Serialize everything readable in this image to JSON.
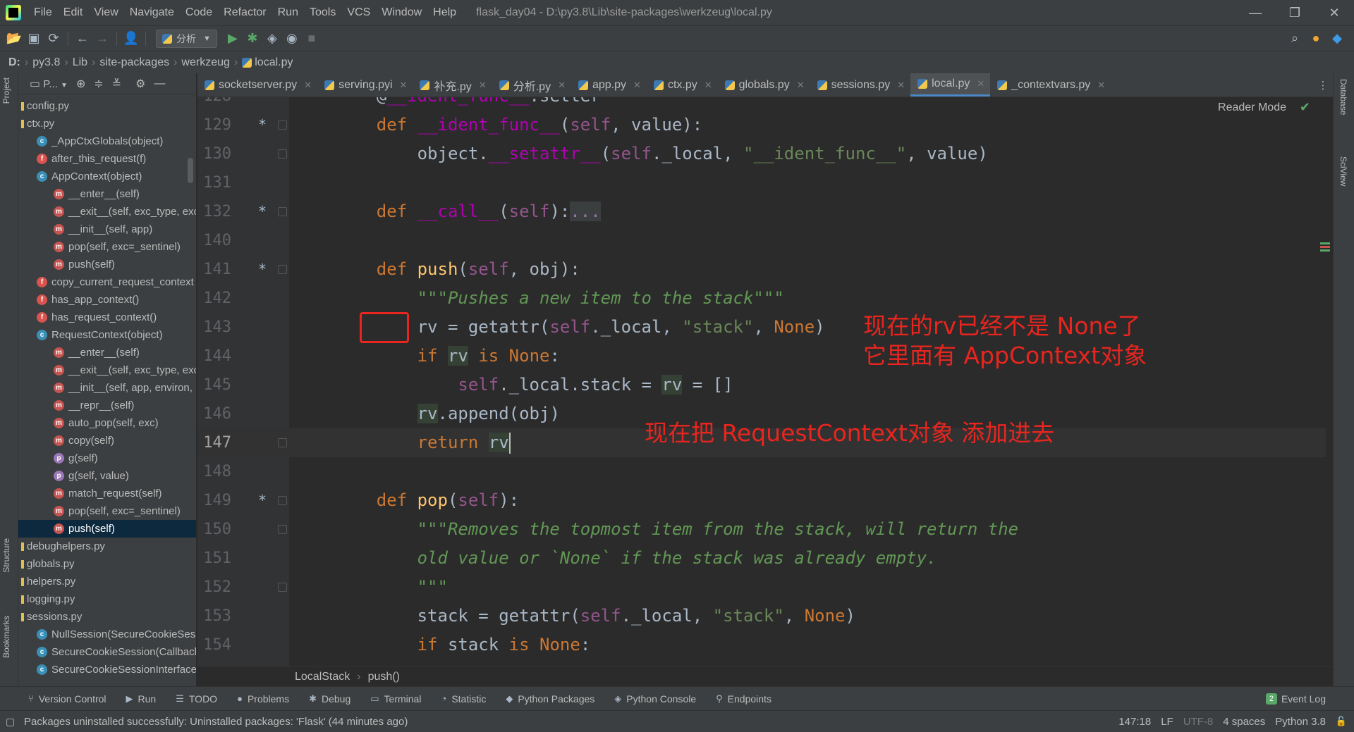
{
  "window": {
    "title": "flask_day04 - D:\\py3.8\\Lib\\site-packages\\werkzeug\\local.py",
    "menu": [
      "File",
      "Edit",
      "View",
      "Navigate",
      "Code",
      "Refactor",
      "Run",
      "Tools",
      "VCS",
      "Window",
      "Help"
    ],
    "controls": {
      "minimize": "—",
      "restore": "❐",
      "close": "✕"
    }
  },
  "toolbar": {
    "run_config": "分析"
  },
  "breadcrumb": [
    "D:",
    "py3.8",
    "Lib",
    "site-packages",
    "werkzeug",
    "local.py"
  ],
  "left_strip": {
    "project": "Project",
    "structure": "Structure",
    "bookmarks": "Bookmarks"
  },
  "right_strip": {
    "database": "Database",
    "sciview": "SciView"
  },
  "project_panel": {
    "title": "P...",
    "tree": [
      {
        "label": "config.py",
        "indent": 0,
        "icon": "file"
      },
      {
        "label": "ctx.py",
        "indent": 0,
        "icon": "file"
      },
      {
        "label": "_AppCtxGlobals(object)",
        "indent": 1,
        "icon": "c"
      },
      {
        "label": "after_this_request(f)",
        "indent": 1,
        "icon": "f"
      },
      {
        "label": "AppContext(object)",
        "indent": 1,
        "icon": "c"
      },
      {
        "label": "__enter__(self)",
        "indent": 2,
        "icon": "m"
      },
      {
        "label": "__exit__(self, exc_type, exc_",
        "indent": 2,
        "icon": "m"
      },
      {
        "label": "__init__(self, app)",
        "indent": 2,
        "icon": "m"
      },
      {
        "label": "pop(self, exc=_sentinel)",
        "indent": 2,
        "icon": "m"
      },
      {
        "label": "push(self)",
        "indent": 2,
        "icon": "m"
      },
      {
        "label": "copy_current_request_context",
        "indent": 1,
        "icon": "f"
      },
      {
        "label": "has_app_context()",
        "indent": 1,
        "icon": "f"
      },
      {
        "label": "has_request_context()",
        "indent": 1,
        "icon": "f"
      },
      {
        "label": "RequestContext(object)",
        "indent": 1,
        "icon": "c"
      },
      {
        "label": "__enter__(self)",
        "indent": 2,
        "icon": "m"
      },
      {
        "label": "__exit__(self, exc_type, exc_",
        "indent": 2,
        "icon": "m"
      },
      {
        "label": "__init__(self, app, environ, re",
        "indent": 2,
        "icon": "m"
      },
      {
        "label": "__repr__(self)",
        "indent": 2,
        "icon": "m"
      },
      {
        "label": "auto_pop(self, exc)",
        "indent": 2,
        "icon": "m"
      },
      {
        "label": "copy(self)",
        "indent": 2,
        "icon": "m"
      },
      {
        "label": "g(self)",
        "indent": 2,
        "icon": "p"
      },
      {
        "label": "g(self, value)",
        "indent": 2,
        "icon": "p"
      },
      {
        "label": "match_request(self)",
        "indent": 2,
        "icon": "m"
      },
      {
        "label": "pop(self, exc=_sentinel)",
        "indent": 2,
        "icon": "m"
      },
      {
        "label": "push(self)",
        "indent": 2,
        "icon": "m",
        "selected": true
      },
      {
        "label": "debughelpers.py",
        "indent": 0,
        "icon": "file"
      },
      {
        "label": "globals.py",
        "indent": 0,
        "icon": "file"
      },
      {
        "label": "helpers.py",
        "indent": 0,
        "icon": "file"
      },
      {
        "label": "logging.py",
        "indent": 0,
        "icon": "file"
      },
      {
        "label": "sessions.py",
        "indent": 0,
        "icon": "file"
      },
      {
        "label": "NullSession(SecureCookieSess",
        "indent": 1,
        "icon": "c"
      },
      {
        "label": "SecureCookieSession(Callback",
        "indent": 1,
        "icon": "c"
      },
      {
        "label": "SecureCookieSessionInterface",
        "indent": 1,
        "icon": "c"
      }
    ]
  },
  "tabs": [
    {
      "label": "socketserver.py",
      "active": false
    },
    {
      "label": "serving.pyi",
      "active": false
    },
    {
      "label": "补充.py",
      "active": false
    },
    {
      "label": "分析.py",
      "active": false
    },
    {
      "label": "app.py",
      "active": false
    },
    {
      "label": "ctx.py",
      "active": false
    },
    {
      "label": "globals.py",
      "active": false
    },
    {
      "label": "sessions.py",
      "active": false
    },
    {
      "label": "local.py",
      "active": true
    },
    {
      "label": "_contextvars.py",
      "active": false
    }
  ],
  "editor": {
    "reader_mode": "Reader Mode",
    "lines": [
      {
        "n": "128",
        "code": "    @__ident_func__.setter"
      },
      {
        "n": "129",
        "code": "    def __ident_func__(self, value):"
      },
      {
        "n": "130",
        "code": "        object.__setattr__(self._local, \"__ident_func__\", value)"
      },
      {
        "n": "131",
        "code": ""
      },
      {
        "n": "132",
        "code": "    def __call__(self):..."
      },
      {
        "n": "140",
        "code": ""
      },
      {
        "n": "141",
        "code": "    def push(self, obj):"
      },
      {
        "n": "142",
        "code": "        \"\"\"Pushes a new item to the stack\"\"\""
      },
      {
        "n": "143",
        "code": "        rv = getattr(self._local, \"stack\", None)"
      },
      {
        "n": "144",
        "code": "        if rv is None:"
      },
      {
        "n": "145",
        "code": "            self._local.stack = rv = []"
      },
      {
        "n": "146",
        "code": "        rv.append(obj)"
      },
      {
        "n": "147",
        "code": "        return rv"
      },
      {
        "n": "148",
        "code": ""
      },
      {
        "n": "149",
        "code": "    def pop(self):"
      },
      {
        "n": "150",
        "code": "        \"\"\"Removes the topmost item from the stack, will return the"
      },
      {
        "n": "151",
        "code": "        old value or `None` if the stack was already empty."
      },
      {
        "n": "152",
        "code": "        \"\"\""
      },
      {
        "n": "153",
        "code": "        stack = getattr(self._local, \"stack\", None)"
      },
      {
        "n": "154",
        "code": "        if stack is None:"
      }
    ],
    "annotations": [
      "现在的rv已经不是 None了",
      "它里面有 AppContext对象",
      "现在把 RequestContext对象 添加进去"
    ]
  },
  "editor_breadcrumb": [
    "LocalStack",
    "push()"
  ],
  "tool_windows": [
    "Version Control",
    "Run",
    "TODO",
    "Problems",
    "Debug",
    "Terminal",
    "Statistic",
    "Python Packages",
    "Python Console",
    "Endpoints"
  ],
  "event_log": {
    "label": "Event Log",
    "count": "2"
  },
  "status": {
    "message": "Packages uninstalled successfully: Uninstalled packages: 'Flask' (44 minutes ago)",
    "position": "147:18",
    "line_sep": "LF",
    "encoding": "UTF-8",
    "indent": "4 spaces",
    "interpreter": "Python 3.8"
  }
}
